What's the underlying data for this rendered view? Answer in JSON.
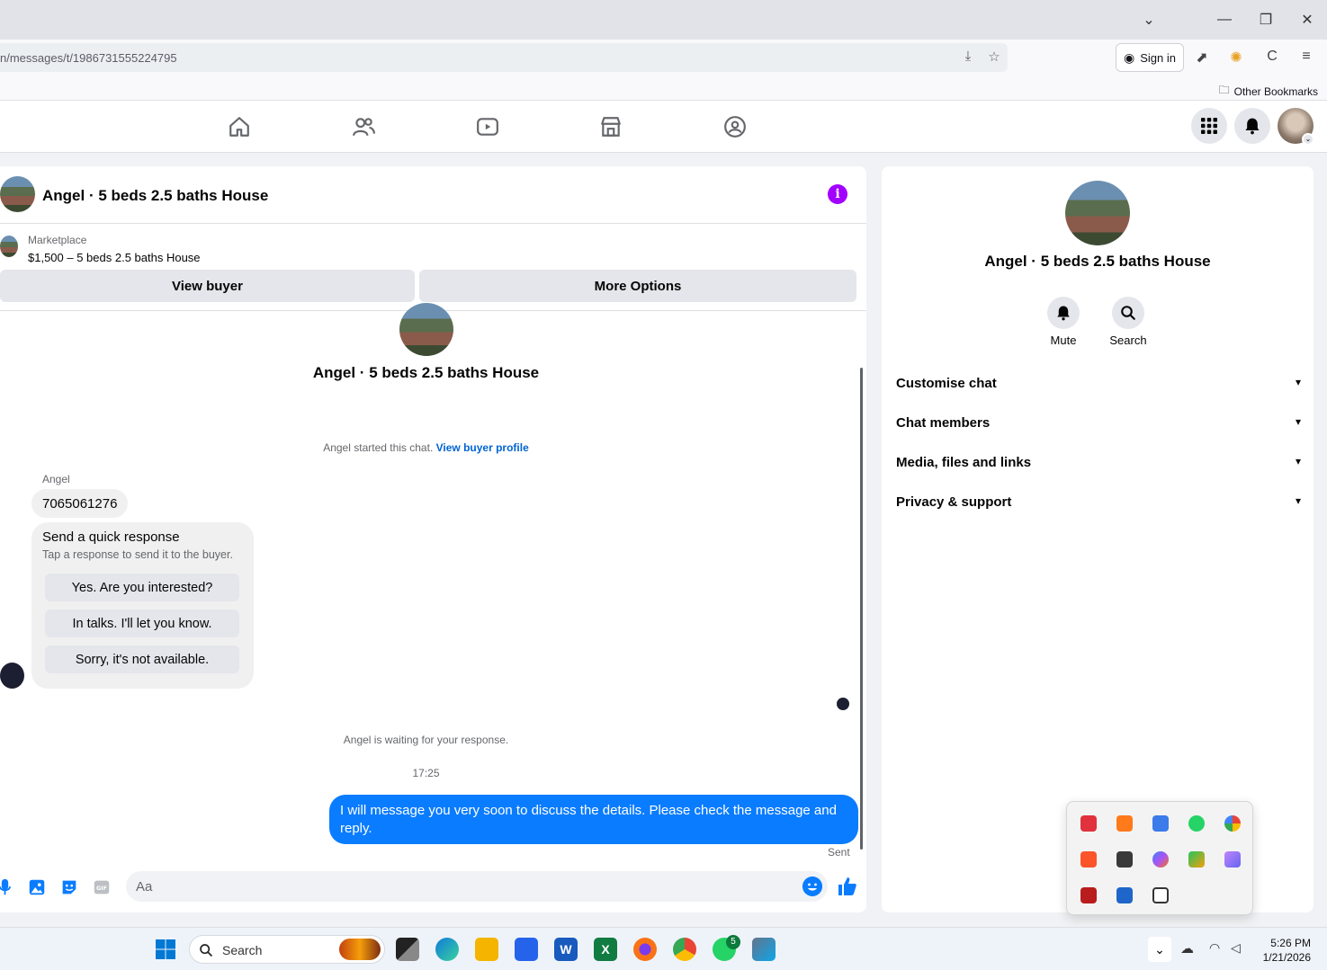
{
  "browser": {
    "url": "n/messages/t/1986731555224795",
    "sign_in": "Sign in",
    "other_bookmarks": "Other Bookmarks"
  },
  "chat": {
    "header_title": "Angel · 5 beds 2.5 baths House",
    "marketplace_label": "Marketplace",
    "listing": "$1,500 – 5 beds 2.5 baths House",
    "view_buyer": "View buyer",
    "more_options": "More Options",
    "thread_name": "Angel · 5 beds 2.5 baths House",
    "started_text": "Angel started this chat.",
    "started_link": "View buyer profile",
    "sender": "Angel",
    "incoming_message": "7065061276",
    "quick_response": {
      "title": "Send a quick response",
      "subtitle": "Tap a response to send it to the buyer.",
      "options": [
        "Yes. Are you interested?",
        "In talks. I'll let you know.",
        "Sorry, it's not available."
      ]
    },
    "waiting": "Angel is waiting for your response.",
    "timestamp": "17:25",
    "outgoing_message": "I will message you very soon to discuss the details. Please check the message and reply.",
    "sent_status": "Sent",
    "composer_placeholder": "Aa"
  },
  "info_panel": {
    "name": "Angel · 5 beds 2.5 baths House",
    "mute": "Mute",
    "search": "Search",
    "sections": [
      "Customise chat",
      "Chat members",
      "Media, files and links",
      "Privacy & support"
    ]
  },
  "taskbar": {
    "search": "Search",
    "whatsapp_badge": "5",
    "time": "5:26 PM",
    "date": "1/21/2026"
  },
  "colors": {
    "messenger_blue": "#0a7cff",
    "info_purple": "#a200ff",
    "link_blue": "#0064d1"
  }
}
